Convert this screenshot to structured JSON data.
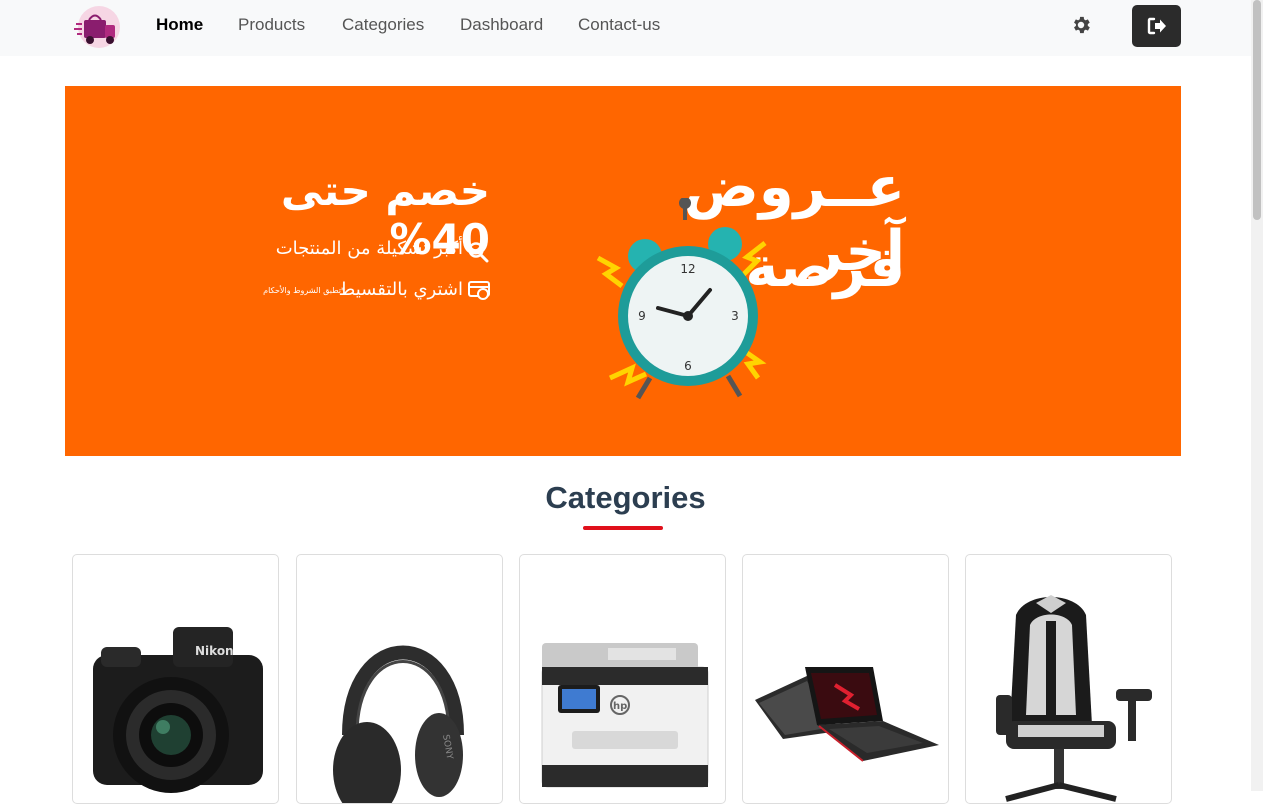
{
  "nav": {
    "links": [
      {
        "label": "Home",
        "active": true
      },
      {
        "label": "Products"
      },
      {
        "label": "Categories"
      },
      {
        "label": "Dashboard"
      },
      {
        "label": "Contact-us"
      }
    ]
  },
  "banner": {
    "headline_line1": "عــروض آخر",
    "headline_line2": "فرصة",
    "discount": "خصم حتى 40%",
    "feature_1": "أكبر تشكيلة من المنتجات",
    "feature_2": "اشتري بالتقسيط",
    "terms": "*تطبق الشروط والأحكام",
    "background_color": "#ff6600"
  },
  "categories_section": {
    "title": "Categories",
    "underline_color": "#e0101b",
    "cards": [
      {
        "image": "camera-image"
      },
      {
        "image": "headphones-image"
      },
      {
        "image": "printer-image"
      },
      {
        "image": "laptop-image"
      },
      {
        "image": "gaming-chair-image"
      }
    ]
  },
  "icons": {
    "logo": "shopping-truck-logo",
    "settings": "gear-icon",
    "logout": "sign-out-icon"
  }
}
